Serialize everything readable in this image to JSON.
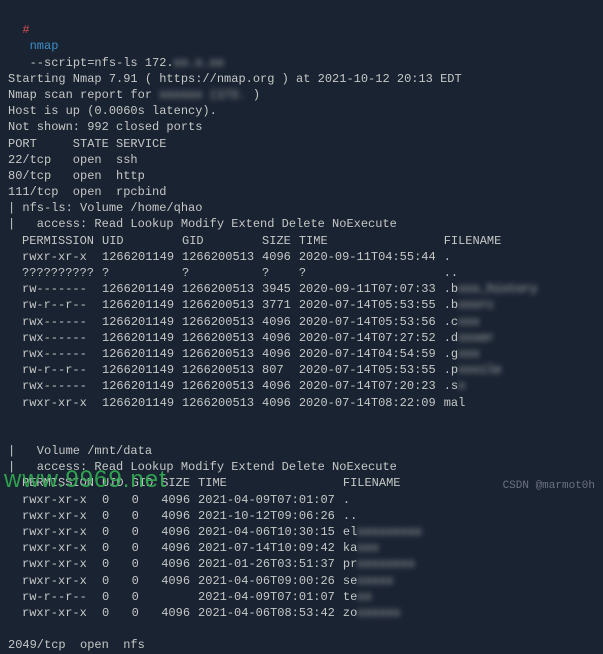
{
  "prompt": {
    "hash": "#",
    "command": "nmap",
    "args": "--script=nfs-ls 172.",
    "args_blur": "xx.x.xx"
  },
  "header": {
    "start": "Starting Nmap 7.91 ( https://nmap.org ) at 2021-10-12 20:13 EDT",
    "report_prefix": "Nmap scan report for ",
    "report_mid": "xxxxxx (172.",
    "report_suf": " )",
    "host": "Host is up (0.0060s latency).",
    "notshown": "Not shown: 992 closed ports"
  },
  "ports_header": "PORT     STATE SERVICE",
  "ports": [
    "22/tcp   open  ssh",
    "80/tcp   open  http",
    "111/tcp  open  rpcbind"
  ],
  "nfs1": {
    "vol": "| nfs-ls: Volume /home/qhao",
    "access": "|   access: Read Lookup Modify Extend Delete NoExecute"
  },
  "cols1": {
    "perm": "PERMISSION",
    "uid": "UID",
    "gid": "GID",
    "size": "SIZE",
    "time": "TIME",
    "file": "FILENAME"
  },
  "rows1": [
    {
      "p": "rwxr-xr-x",
      "u": "1266201149",
      "g": "1266200513",
      "s": "4096",
      "t": "2020-09-11T04:55:44",
      "f": ".",
      "bl": ""
    },
    {
      "p": "??????????",
      "u": "?",
      "g": "?",
      "s": "?",
      "t": "?",
      "f": "..",
      "bl": ""
    },
    {
      "p": "rw-------",
      "u": "1266201149",
      "g": "1266200513",
      "s": "3945",
      "t": "2020-09-11T07:07:33",
      "f": ".b",
      "bl": "xxx_history"
    },
    {
      "p": "rw-r--r--",
      "u": "1266201149",
      "g": "1266200513",
      "s": "3771",
      "t": "2020-07-14T05:53:55",
      "f": ".b",
      "bl": "xxxrc"
    },
    {
      "p": "rwx------",
      "u": "1266201149",
      "g": "1266200513",
      "s": "4096",
      "t": "2020-07-14T05:53:56",
      "f": ".c",
      "bl": "xxx"
    },
    {
      "p": "rwx------",
      "u": "1266201149",
      "g": "1266200513",
      "s": "4096",
      "t": "2020-07-14T07:27:52",
      "f": ".d",
      "bl": "xxxer"
    },
    {
      "p": "rwx------",
      "u": "1266201149",
      "g": "1266200513",
      "s": "4096",
      "t": "2020-07-14T04:54:59",
      "f": ".g",
      "bl": "xxx"
    },
    {
      "p": "rw-r--r--",
      "u": "1266201149",
      "g": "1266200513",
      "s": "807",
      "t": "2020-07-14T05:53:55",
      "f": ".p",
      "bl": "xxxile"
    },
    {
      "p": "rwx------",
      "u": "1266201149",
      "g": "1266200513",
      "s": "4096",
      "t": "2020-07-14T07:20:23",
      "f": ".s",
      "bl": "x"
    },
    {
      "p": "rwxr-xr-x",
      "u": "1266201149",
      "g": "1266200513",
      "s": "4096",
      "t": "2020-07-14T08:22:09",
      "f": "mal",
      "bl": ""
    }
  ],
  "nfs2": {
    "vol": "|   Volume /mnt/data",
    "access": "|   access: Read Lookup Modify Extend Delete NoExecute"
  },
  "cols2": {
    "perm": "PERMISSION",
    "uid": "UID",
    "gid": "GID",
    "size": "SIZE",
    "time": "TIME",
    "file": "FILENAME"
  },
  "rows2": [
    {
      "p": "rwxr-xr-x",
      "u": "0",
      "g": "0",
      "s": "4096",
      "t": "2021-04-09T07:01:07",
      "f": ".",
      "bl": ""
    },
    {
      "p": "rwxr-xr-x",
      "u": "0",
      "g": "0",
      "s": "4096",
      "t": "2021-10-12T09:06:26",
      "f": "..",
      "bl": ""
    },
    {
      "p": "rwxr-xr-x",
      "u": "0",
      "g": "0",
      "s": "4096",
      "t": "2021-04-06T10:30:15",
      "f": "el",
      "bl": "xxxxxxxxx"
    },
    {
      "p": "rwxr-xr-x",
      "u": "0",
      "g": "0",
      "s": "4096",
      "t": "2021-07-14T10:09:42",
      "f": "ka",
      "bl": "xxx"
    },
    {
      "p": "rwxr-xr-x",
      "u": "0",
      "g": "0",
      "s": "4096",
      "t": "2021-01-26T03:51:37",
      "f": "pr",
      "bl": "xxxxxxxx"
    },
    {
      "p": "rwxr-xr-x",
      "u": "0",
      "g": "0",
      "s": "4096",
      "t": "2021-04-06T09:00:26",
      "f": "se",
      "bl": "xxxxx"
    },
    {
      "p": "rw-r--r--",
      "u": "0",
      "g": "0",
      "s": "",
      "t": "2021-04-09T07:01:07",
      "f": "te",
      "bl": "xx"
    },
    {
      "p": "rwxr-xr-x",
      "u": "0",
      "g": "0",
      "s": "4096",
      "t": "2021-04-06T08:53:42",
      "f": "zo",
      "bl": "xxxxxx"
    }
  ],
  "tail": "2049/tcp  open  nfs",
  "watermark": "www.9969.net",
  "credit": "CSDN @marmot0h"
}
